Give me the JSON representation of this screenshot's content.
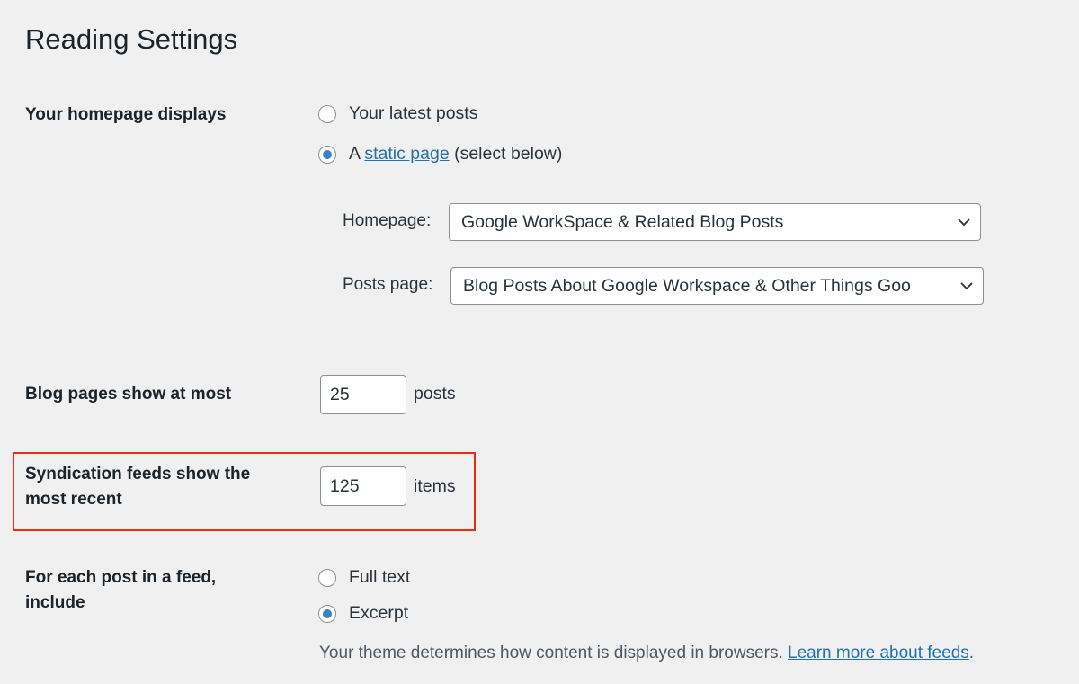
{
  "page": {
    "title": "Reading Settings"
  },
  "homepage_displays": {
    "label": "Your homepage displays",
    "options": [
      {
        "label": "Your latest posts",
        "checked": false
      },
      {
        "prefix": "A ",
        "link": "static page",
        "suffix": " (select below)",
        "checked": true
      }
    ],
    "homepage_select": {
      "label": "Homepage:",
      "value": "Google WorkSpace & Related Blog Posts"
    },
    "posts_page_select": {
      "label": "Posts page:",
      "value": "Blog Posts About Google Workspace & Other Things Goo"
    }
  },
  "blog_pages": {
    "label": "Blog pages show at most",
    "value": "25",
    "unit": "posts"
  },
  "syndication": {
    "label_line1": "Syndication feeds show the",
    "label_line2": "most recent",
    "value": "125",
    "unit": "items",
    "highlight_color": "#ef2d0e"
  },
  "feed_content": {
    "label_line1": "For each post in a feed,",
    "label_line2": "include",
    "options": [
      {
        "label": "Full text",
        "checked": false
      },
      {
        "label": "Excerpt",
        "checked": true
      }
    ],
    "description": "Your theme determines how content is displayed in browsers. ",
    "description_link": "Learn more about feeds",
    "description_end": "."
  },
  "colors": {
    "accent": "#3582c4",
    "link": "#2271b1"
  }
}
